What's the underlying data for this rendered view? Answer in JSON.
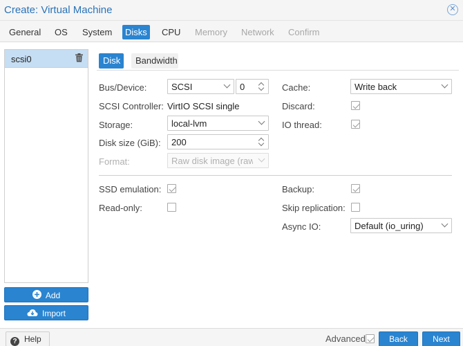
{
  "window": {
    "title": "Create: Virtual Machine"
  },
  "tabs": [
    {
      "label": "General",
      "state": "normal"
    },
    {
      "label": "OS",
      "state": "normal"
    },
    {
      "label": "System",
      "state": "normal"
    },
    {
      "label": "Disks",
      "state": "active"
    },
    {
      "label": "CPU",
      "state": "normal"
    },
    {
      "label": "Memory",
      "state": "disabled"
    },
    {
      "label": "Network",
      "state": "disabled"
    },
    {
      "label": "Confirm",
      "state": "disabled"
    }
  ],
  "disk_list": {
    "items": [
      "scsi0"
    ]
  },
  "left_buttons": {
    "add": "Add",
    "import": "Import"
  },
  "subtabs": {
    "disk": "Disk",
    "bandwidth": "Bandwidth"
  },
  "form": {
    "bus_device_label": "Bus/Device:",
    "bus_value": "SCSI",
    "device_value": "0",
    "scsi_controller_label": "SCSI Controller:",
    "scsi_controller_value": "VirtIO SCSI single",
    "storage_label": "Storage:",
    "storage_value": "local-lvm",
    "disk_size_label": "Disk size (GiB):",
    "disk_size_value": "200",
    "format_label": "Format:",
    "format_value": "Raw disk image (raw)",
    "cache_label": "Cache:",
    "cache_value": "Write back",
    "discard_label": "Discard:",
    "iothread_label": "IO thread:",
    "ssd_label": "SSD emulation:",
    "readonly_label": "Read-only:",
    "backup_label": "Backup:",
    "skip_replication_label": "Skip replication:",
    "async_io_label": "Async IO:",
    "async_io_value": "Default (io_uring)"
  },
  "checkbox_states": {
    "discard": true,
    "iothread": true,
    "ssd": true,
    "readonly": false,
    "backup": true,
    "skip_replication": false,
    "advanced": true
  },
  "footer": {
    "help": "Help",
    "advanced": "Advanced",
    "back": "Back",
    "next": "Next"
  },
  "colors": {
    "accent": "#2a84d0",
    "title": "#2a73b8",
    "selected_row": "#c6def3"
  }
}
